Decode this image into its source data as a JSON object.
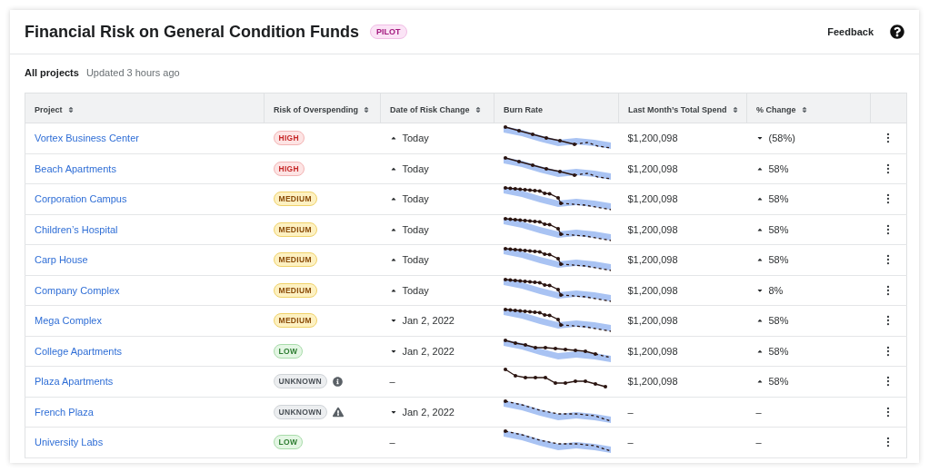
{
  "header": {
    "title": "Financial Risk on General Condition Funds",
    "badge": "PILOT",
    "feedback": "Feedback"
  },
  "subheader": {
    "scope": "All projects",
    "updated": "Updated 3 hours ago"
  },
  "table": {
    "columns": [
      {
        "label": "Project",
        "sortable": true
      },
      {
        "label": "Risk of Overspending",
        "sortable": true
      },
      {
        "label": "Date of Risk Change",
        "sortable": true
      },
      {
        "label": "Burn Rate",
        "sortable": false
      },
      {
        "label": "Last Month’s Total Spend",
        "sortable": true
      },
      {
        "label": "% Change",
        "sortable": true
      }
    ],
    "rows": [
      {
        "project": "Vortex Business Center",
        "risk": {
          "label": "HIGH",
          "kind": "high"
        },
        "date": "Today",
        "risk_rising": true,
        "burn_rate": {
          "kind": "linear"
        },
        "spend": "$1,200,098",
        "change": "(58%)",
        "change_rising": false
      },
      {
        "project": "Beach Apartments",
        "risk": {
          "label": "HIGH",
          "kind": "high"
        },
        "date": "Today",
        "risk_rising": true,
        "burn_rate": {
          "kind": "linear"
        },
        "spend": "$1,200,098",
        "change": "58%",
        "change_rising": true
      },
      {
        "project": "Corporation Campus",
        "risk": {
          "label": "MEDIUM",
          "kind": "medium"
        },
        "date": "Today",
        "risk_rising": true,
        "burn_rate": {
          "kind": "drop"
        },
        "spend": "$1,200,098",
        "change": "58%",
        "change_rising": true
      },
      {
        "project": "Children’s Hospital",
        "risk": {
          "label": "MEDIUM",
          "kind": "medium"
        },
        "date": "Today",
        "risk_rising": true,
        "burn_rate": {
          "kind": "drop"
        },
        "spend": "$1,200,098",
        "change": "58%",
        "change_rising": true
      },
      {
        "project": "Carp House",
        "risk": {
          "label": "MEDIUM",
          "kind": "medium"
        },
        "date": "Today",
        "risk_rising": true,
        "burn_rate": {
          "kind": "drop"
        },
        "spend": "$1,200,098",
        "change": "58%",
        "change_rising": true
      },
      {
        "project": "Company Complex",
        "risk": {
          "label": "MEDIUM",
          "kind": "medium"
        },
        "date": "Today",
        "risk_rising": true,
        "burn_rate": {
          "kind": "drop"
        },
        "spend": "$1,200,098",
        "change": "8%",
        "change_rising": false
      },
      {
        "project": "Mega Complex",
        "risk": {
          "label": "MEDIUM",
          "kind": "medium"
        },
        "date": "Jan 2, 2022",
        "risk_rising": false,
        "burn_rate": {
          "kind": "drop"
        },
        "spend": "$1,200,098",
        "change": "58%",
        "change_rising": true
      },
      {
        "project": "College Apartments",
        "risk": {
          "label": "LOW",
          "kind": "low"
        },
        "date": "Jan 2, 2022",
        "risk_rising": false,
        "burn_rate": {
          "kind": "meander"
        },
        "spend": "$1,200,098",
        "change": "58%",
        "change_rising": true
      },
      {
        "project": "Plaza Apartments",
        "risk": {
          "label": "UNKNOWN",
          "kind": "unknown",
          "info": true
        },
        "date": "–",
        "burn_rate": {
          "kind": "solid"
        },
        "spend": "$1,200,098",
        "change": "58%",
        "change_rising": true
      },
      {
        "project": "French Plaza",
        "risk": {
          "label": "UNKNOWN",
          "kind": "unknown",
          "warning": true
        },
        "date": "Jan 2, 2022",
        "risk_rising": false,
        "burn_rate": {
          "kind": "forecast"
        },
        "spend": "–",
        "change": "–"
      },
      {
        "project": "University Labs",
        "risk": {
          "label": "LOW",
          "kind": "low"
        },
        "date": "–",
        "burn_rate": {
          "kind": "forecast"
        },
        "spend": "–",
        "change": "–"
      }
    ]
  }
}
